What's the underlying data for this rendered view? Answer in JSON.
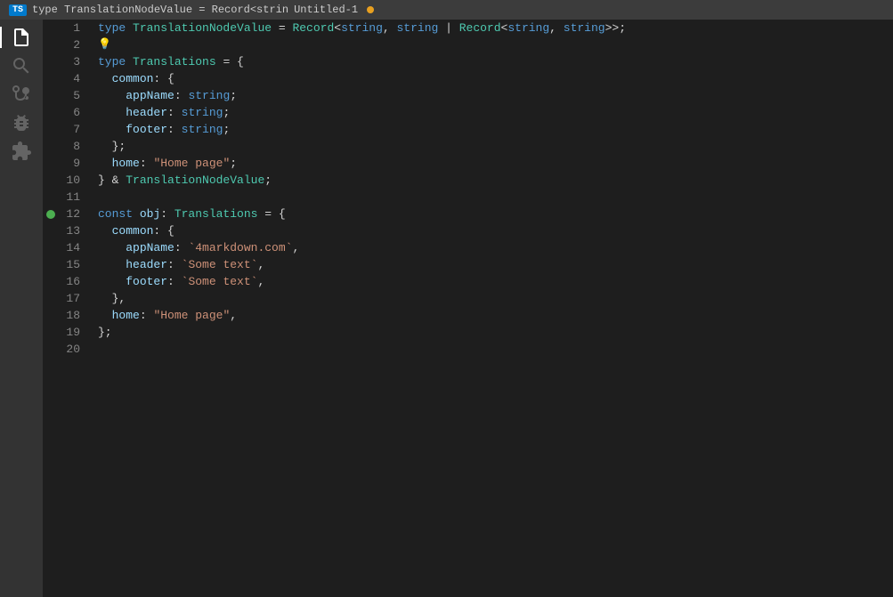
{
  "titleBar": {
    "tsBadge": "TS",
    "fileName": "type TranslationNodeValue = Record<strin",
    "tabName": "Untitled-1",
    "modified": true
  },
  "activityBar": {
    "icons": [
      {
        "name": "files-icon",
        "symbol": "⎘",
        "active": true
      },
      {
        "name": "search-icon",
        "symbol": "⌕",
        "active": false
      },
      {
        "name": "source-control-icon",
        "symbol": "⎇",
        "active": false
      },
      {
        "name": "debug-icon",
        "symbol": "▷",
        "active": false
      },
      {
        "name": "extensions-icon",
        "symbol": "⊞",
        "active": false
      }
    ]
  },
  "code": {
    "lines": [
      {
        "num": 1,
        "tokens": [
          {
            "cls": "kw",
            "text": "type "
          },
          {
            "cls": "type-name",
            "text": "TranslationNodeValue"
          },
          {
            "cls": "plain",
            "text": " = "
          },
          {
            "cls": "builtin",
            "text": "Record"
          },
          {
            "cls": "punct",
            "text": "<"
          },
          {
            "cls": "kw",
            "text": "string"
          },
          {
            "cls": "plain",
            "text": ", "
          },
          {
            "cls": "kw",
            "text": "string"
          },
          {
            "cls": "plain",
            "text": " | "
          },
          {
            "cls": "builtin",
            "text": "Record"
          },
          {
            "cls": "punct",
            "text": "<"
          },
          {
            "cls": "kw",
            "text": "string"
          },
          {
            "cls": "plain",
            "text": ", "
          },
          {
            "cls": "kw",
            "text": "string"
          },
          {
            "cls": "plain",
            "text": ">>"
          },
          {
            "cls": "plain",
            "text": ";"
          }
        ]
      },
      {
        "num": 2,
        "lightbulb": true,
        "tokens": []
      },
      {
        "num": 3,
        "tokens": [
          {
            "cls": "kw",
            "text": "type "
          },
          {
            "cls": "type-name",
            "text": "Translations"
          },
          {
            "cls": "plain",
            "text": " = {"
          }
        ]
      },
      {
        "num": 4,
        "tokens": [
          {
            "cls": "plain",
            "text": "  "
          },
          {
            "cls": "prop",
            "text": "common"
          },
          {
            "cls": "plain",
            "text": ": {"
          }
        ]
      },
      {
        "num": 5,
        "tokens": [
          {
            "cls": "plain",
            "text": "    "
          },
          {
            "cls": "prop",
            "text": "appName"
          },
          {
            "cls": "plain",
            "text": ": "
          },
          {
            "cls": "kw",
            "text": "string"
          },
          {
            "cls": "plain",
            "text": ";"
          }
        ]
      },
      {
        "num": 6,
        "tokens": [
          {
            "cls": "plain",
            "text": "    "
          },
          {
            "cls": "prop",
            "text": "header"
          },
          {
            "cls": "plain",
            "text": ": "
          },
          {
            "cls": "kw",
            "text": "string"
          },
          {
            "cls": "plain",
            "text": ";"
          }
        ]
      },
      {
        "num": 7,
        "tokens": [
          {
            "cls": "plain",
            "text": "    "
          },
          {
            "cls": "prop",
            "text": "footer"
          },
          {
            "cls": "plain",
            "text": ": "
          },
          {
            "cls": "kw",
            "text": "string"
          },
          {
            "cls": "plain",
            "text": ";"
          }
        ]
      },
      {
        "num": 8,
        "tokens": [
          {
            "cls": "plain",
            "text": "  };"
          }
        ]
      },
      {
        "num": 9,
        "tokens": [
          {
            "cls": "plain",
            "text": "  "
          },
          {
            "cls": "prop",
            "text": "home"
          },
          {
            "cls": "plain",
            "text": ": "
          },
          {
            "cls": "str",
            "text": "\"Home page\""
          },
          {
            "cls": "plain",
            "text": ";"
          }
        ]
      },
      {
        "num": 10,
        "tokens": [
          {
            "cls": "plain",
            "text": "} & "
          },
          {
            "cls": "type-name",
            "text": "TranslationNodeValue"
          },
          {
            "cls": "plain",
            "text": ";"
          }
        ]
      },
      {
        "num": 11,
        "tokens": []
      },
      {
        "num": 12,
        "breakpoint": true,
        "tokens": [
          {
            "cls": "kw",
            "text": "const "
          },
          {
            "cls": "prop",
            "text": "obj"
          },
          {
            "cls": "plain",
            "text": ": "
          },
          {
            "cls": "type-name",
            "text": "Translations"
          },
          {
            "cls": "plain",
            "text": " = {"
          }
        ]
      },
      {
        "num": 13,
        "tokens": [
          {
            "cls": "plain",
            "text": "  "
          },
          {
            "cls": "prop",
            "text": "common"
          },
          {
            "cls": "plain",
            "text": ": {"
          }
        ]
      },
      {
        "num": 14,
        "tokens": [
          {
            "cls": "plain",
            "text": "    "
          },
          {
            "cls": "prop",
            "text": "appName"
          },
          {
            "cls": "plain",
            "text": ": "
          },
          {
            "cls": "template",
            "text": "`4markdown.com`"
          },
          {
            "cls": "plain",
            "text": ","
          }
        ]
      },
      {
        "num": 15,
        "tokens": [
          {
            "cls": "plain",
            "text": "    "
          },
          {
            "cls": "prop",
            "text": "header"
          },
          {
            "cls": "plain",
            "text": ": "
          },
          {
            "cls": "template",
            "text": "`Some text`"
          },
          {
            "cls": "plain",
            "text": ","
          }
        ]
      },
      {
        "num": 16,
        "tokens": [
          {
            "cls": "plain",
            "text": "    "
          },
          {
            "cls": "prop",
            "text": "footer"
          },
          {
            "cls": "plain",
            "text": ": "
          },
          {
            "cls": "template",
            "text": "`Some text`"
          },
          {
            "cls": "plain",
            "text": ","
          }
        ]
      },
      {
        "num": 17,
        "tokens": [
          {
            "cls": "plain",
            "text": "  },"
          }
        ]
      },
      {
        "num": 18,
        "tokens": [
          {
            "cls": "plain",
            "text": "  "
          },
          {
            "cls": "prop",
            "text": "home"
          },
          {
            "cls": "plain",
            "text": ": "
          },
          {
            "cls": "str",
            "text": "\"Home page\""
          },
          {
            "cls": "plain",
            "text": ","
          }
        ]
      },
      {
        "num": 19,
        "tokens": [
          {
            "cls": "plain",
            "text": "};"
          }
        ]
      },
      {
        "num": 20,
        "tokens": []
      }
    ]
  }
}
